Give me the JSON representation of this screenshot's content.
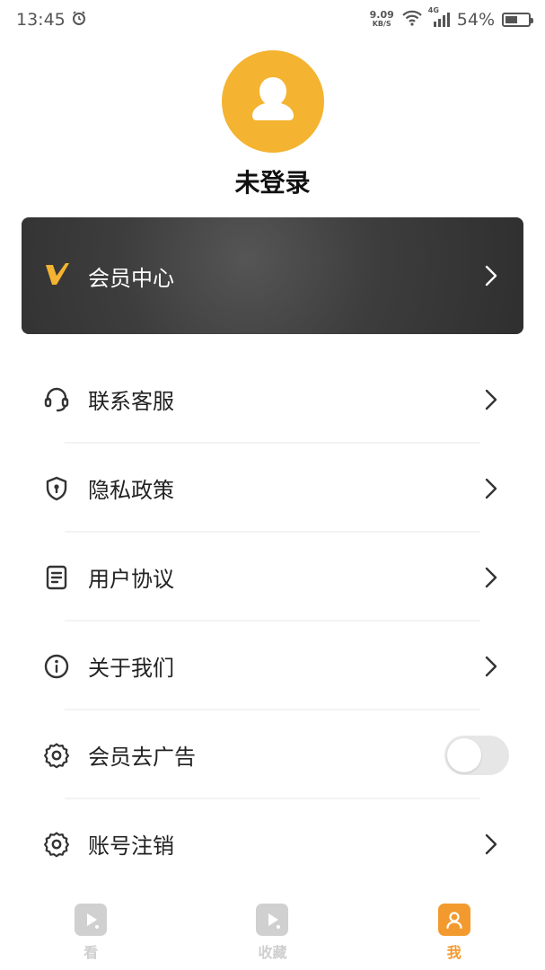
{
  "status_bar": {
    "time": "13:45",
    "net_speed_value": "9.09",
    "net_speed_unit": "KB/S",
    "network_type": "4G",
    "battery": "54%",
    "battery_level": 0.54
  },
  "profile": {
    "username": "未登录"
  },
  "vip": {
    "label": "会员中心",
    "accent_color": "#f4b330"
  },
  "menu": {
    "items": [
      {
        "label": "联系客服",
        "icon": "headset-icon"
      },
      {
        "label": "隐私政策",
        "icon": "shield-lock-icon"
      },
      {
        "label": "用户协议",
        "icon": "document-icon"
      },
      {
        "label": "关于我们",
        "icon": "info-icon"
      },
      {
        "label": "会员去广告",
        "icon": "gear-icon",
        "toggle": false
      },
      {
        "label": "账号注销",
        "icon": "gear-icon"
      }
    ]
  },
  "bottom_nav": {
    "items": [
      {
        "label": "看",
        "icon": "video-icon",
        "active": false
      },
      {
        "label": "收藏",
        "icon": "video-icon",
        "active": false
      },
      {
        "label": "我",
        "icon": "user-icon",
        "active": true
      }
    ],
    "active_color": "#f39a2e",
    "inactive_color": "#cfcfcf"
  }
}
